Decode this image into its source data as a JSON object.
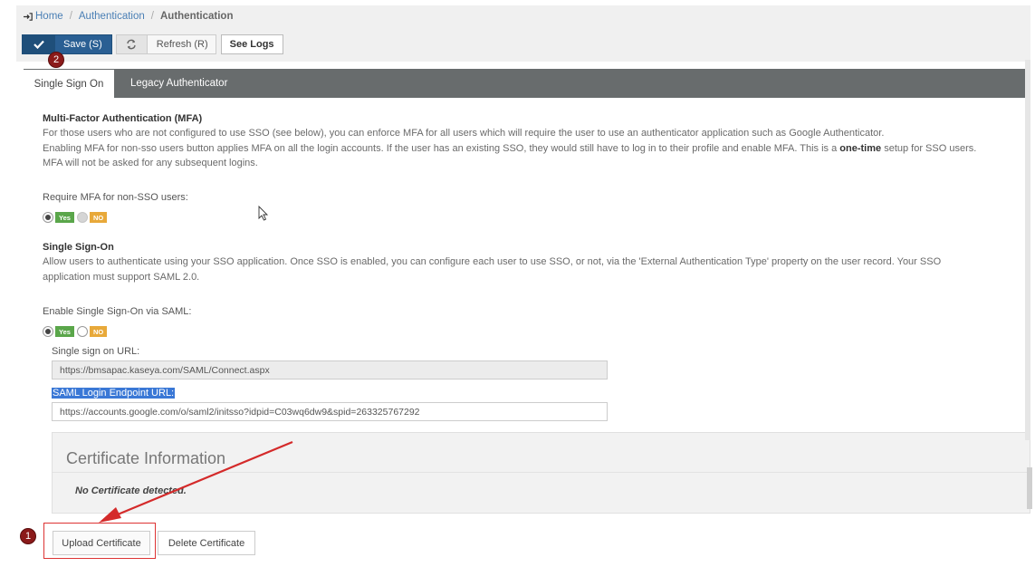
{
  "breadcrumb": {
    "home": "Home",
    "level1": "Authentication",
    "current": "Authentication"
  },
  "toolbar": {
    "save_label": "Save (S)",
    "refresh_label": "Refresh (R)",
    "logs_label": "See Logs"
  },
  "tabs": [
    {
      "label": "Single Sign On"
    },
    {
      "label": "Legacy Authenticator"
    }
  ],
  "mfa": {
    "title": "Multi-Factor Authentication (MFA)",
    "line1": "For those users who are not configured to use SSO (see below), you can enforce MFA for all users which will require the user to use an authenticator application such as Google Authenticator.",
    "line2_a": "Enabling MFA for non-sso users button applies MFA on all the login accounts. If the user has an existing SSO, they would still have to log in to their profile and enable MFA. This is a ",
    "line2_bold": "one-time",
    "line2_b": " setup for SSO users.",
    "line3": "MFA will not be asked for any subsequent logins.",
    "require_label": "Require MFA for non-SSO users:",
    "yes": "Yes",
    "no": "NO"
  },
  "sso": {
    "title": "Single Sign-On",
    "line1": "Allow users to authenticate using your SSO application. Once SSO is enabled, you can configure each user to use SSO, or not, via the 'External Authentication Type' property on the user record. Your SSO",
    "line2": "application must support SAML 2.0.",
    "enable_label": "Enable Single Sign-On via SAML:",
    "yes": "Yes",
    "no": "NO",
    "url_label": "Single sign on URL:",
    "url_value": "https://bmsapac.kaseya.com/SAML/Connect.aspx",
    "endpoint_label": "SAML Login Endpoint URL:",
    "endpoint_value": "https://accounts.google.com/o/saml2/initsso?idpid=C03wq6dw9&spid=263325767292"
  },
  "certificate": {
    "title": "Certificate Information",
    "status": "No Certificate detected."
  },
  "actions": {
    "upload_label": "Upload Certificate",
    "delete_label": "Delete Certificate"
  },
  "annotations": {
    "badge1": "1",
    "badge2": "2"
  },
  "colors": {
    "save": "#2a5f93",
    "tabs_bar": "#686c6d",
    "yes": "#5aa64a",
    "no": "#e8a93a",
    "annotation": "#d33",
    "badge": "#8b1a1a"
  }
}
